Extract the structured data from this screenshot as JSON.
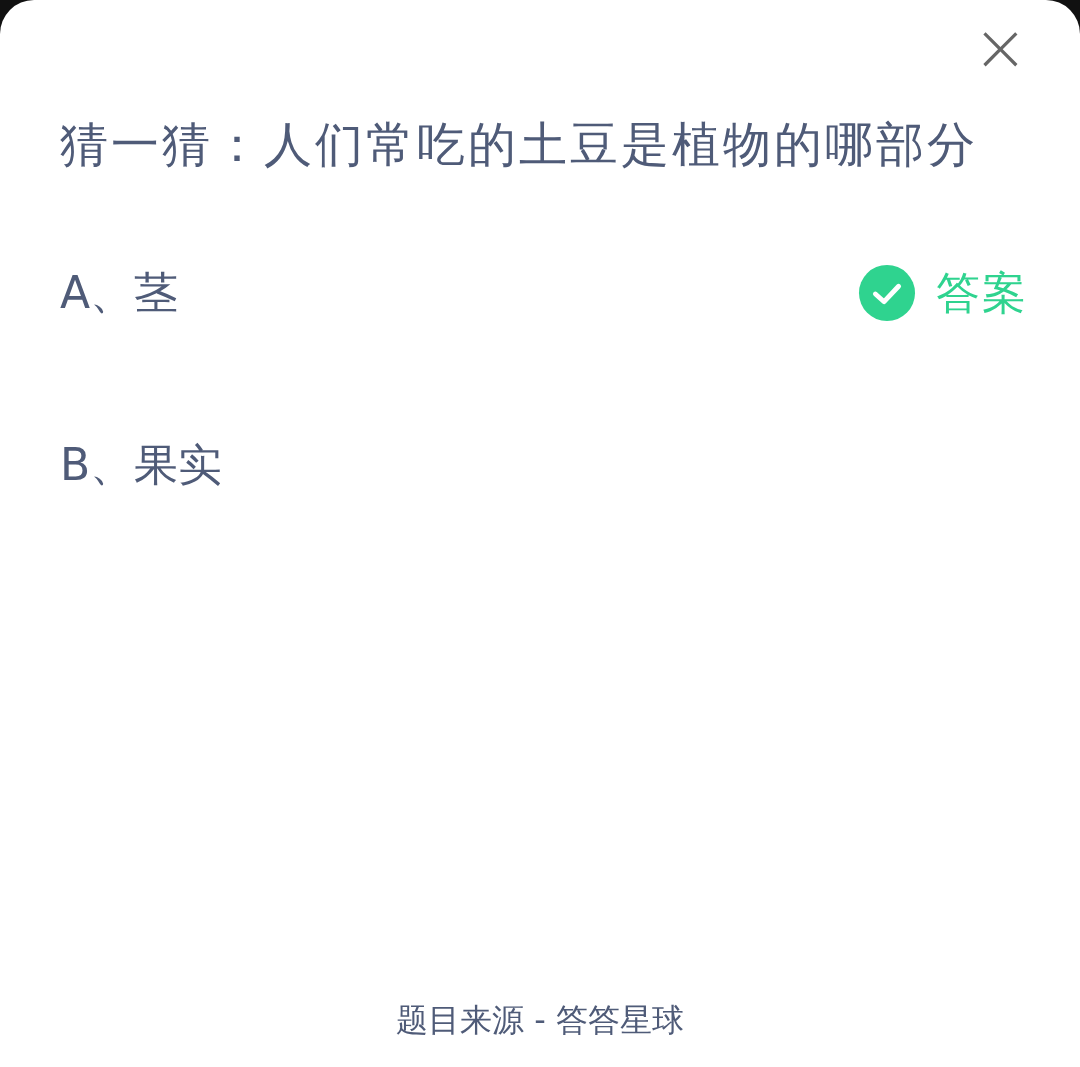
{
  "close_button": "×",
  "question": "猜一猜：人们常吃的土豆是植物的哪部分",
  "answer_badge": "答案",
  "options": [
    {
      "text": "A、茎",
      "correct": true
    },
    {
      "text": "B、果实",
      "correct": false
    }
  ],
  "footer": "题目来源 - 答答星球"
}
